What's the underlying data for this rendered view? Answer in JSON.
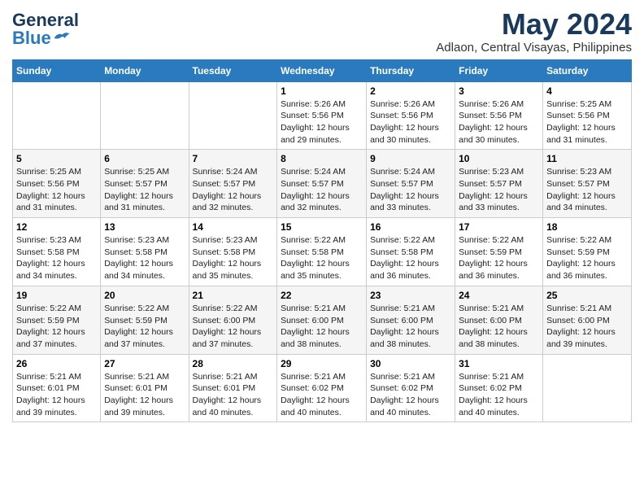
{
  "header": {
    "logo_general": "General",
    "logo_blue": "Blue",
    "month_title": "May 2024",
    "location": "Adlaon, Central Visayas, Philippines"
  },
  "days_of_week": [
    "Sunday",
    "Monday",
    "Tuesday",
    "Wednesday",
    "Thursday",
    "Friday",
    "Saturday"
  ],
  "weeks": [
    [
      {
        "day": "",
        "info": ""
      },
      {
        "day": "",
        "info": ""
      },
      {
        "day": "",
        "info": ""
      },
      {
        "day": "1",
        "info": "Sunrise: 5:26 AM\nSunset: 5:56 PM\nDaylight: 12 hours and 29 minutes."
      },
      {
        "day": "2",
        "info": "Sunrise: 5:26 AM\nSunset: 5:56 PM\nDaylight: 12 hours and 30 minutes."
      },
      {
        "day": "3",
        "info": "Sunrise: 5:26 AM\nSunset: 5:56 PM\nDaylight: 12 hours and 30 minutes."
      },
      {
        "day": "4",
        "info": "Sunrise: 5:25 AM\nSunset: 5:56 PM\nDaylight: 12 hours and 31 minutes."
      }
    ],
    [
      {
        "day": "5",
        "info": "Sunrise: 5:25 AM\nSunset: 5:56 PM\nDaylight: 12 hours and 31 minutes."
      },
      {
        "day": "6",
        "info": "Sunrise: 5:25 AM\nSunset: 5:57 PM\nDaylight: 12 hours and 31 minutes."
      },
      {
        "day": "7",
        "info": "Sunrise: 5:24 AM\nSunset: 5:57 PM\nDaylight: 12 hours and 32 minutes."
      },
      {
        "day": "8",
        "info": "Sunrise: 5:24 AM\nSunset: 5:57 PM\nDaylight: 12 hours and 32 minutes."
      },
      {
        "day": "9",
        "info": "Sunrise: 5:24 AM\nSunset: 5:57 PM\nDaylight: 12 hours and 33 minutes."
      },
      {
        "day": "10",
        "info": "Sunrise: 5:23 AM\nSunset: 5:57 PM\nDaylight: 12 hours and 33 minutes."
      },
      {
        "day": "11",
        "info": "Sunrise: 5:23 AM\nSunset: 5:57 PM\nDaylight: 12 hours and 34 minutes."
      }
    ],
    [
      {
        "day": "12",
        "info": "Sunrise: 5:23 AM\nSunset: 5:58 PM\nDaylight: 12 hours and 34 minutes."
      },
      {
        "day": "13",
        "info": "Sunrise: 5:23 AM\nSunset: 5:58 PM\nDaylight: 12 hours and 34 minutes."
      },
      {
        "day": "14",
        "info": "Sunrise: 5:23 AM\nSunset: 5:58 PM\nDaylight: 12 hours and 35 minutes."
      },
      {
        "day": "15",
        "info": "Sunrise: 5:22 AM\nSunset: 5:58 PM\nDaylight: 12 hours and 35 minutes."
      },
      {
        "day": "16",
        "info": "Sunrise: 5:22 AM\nSunset: 5:58 PM\nDaylight: 12 hours and 36 minutes."
      },
      {
        "day": "17",
        "info": "Sunrise: 5:22 AM\nSunset: 5:59 PM\nDaylight: 12 hours and 36 minutes."
      },
      {
        "day": "18",
        "info": "Sunrise: 5:22 AM\nSunset: 5:59 PM\nDaylight: 12 hours and 36 minutes."
      }
    ],
    [
      {
        "day": "19",
        "info": "Sunrise: 5:22 AM\nSunset: 5:59 PM\nDaylight: 12 hours and 37 minutes."
      },
      {
        "day": "20",
        "info": "Sunrise: 5:22 AM\nSunset: 5:59 PM\nDaylight: 12 hours and 37 minutes."
      },
      {
        "day": "21",
        "info": "Sunrise: 5:22 AM\nSunset: 6:00 PM\nDaylight: 12 hours and 37 minutes."
      },
      {
        "day": "22",
        "info": "Sunrise: 5:21 AM\nSunset: 6:00 PM\nDaylight: 12 hours and 38 minutes."
      },
      {
        "day": "23",
        "info": "Sunrise: 5:21 AM\nSunset: 6:00 PM\nDaylight: 12 hours and 38 minutes."
      },
      {
        "day": "24",
        "info": "Sunrise: 5:21 AM\nSunset: 6:00 PM\nDaylight: 12 hours and 38 minutes."
      },
      {
        "day": "25",
        "info": "Sunrise: 5:21 AM\nSunset: 6:00 PM\nDaylight: 12 hours and 39 minutes."
      }
    ],
    [
      {
        "day": "26",
        "info": "Sunrise: 5:21 AM\nSunset: 6:01 PM\nDaylight: 12 hours and 39 minutes."
      },
      {
        "day": "27",
        "info": "Sunrise: 5:21 AM\nSunset: 6:01 PM\nDaylight: 12 hours and 39 minutes."
      },
      {
        "day": "28",
        "info": "Sunrise: 5:21 AM\nSunset: 6:01 PM\nDaylight: 12 hours and 40 minutes."
      },
      {
        "day": "29",
        "info": "Sunrise: 5:21 AM\nSunset: 6:02 PM\nDaylight: 12 hours and 40 minutes."
      },
      {
        "day": "30",
        "info": "Sunrise: 5:21 AM\nSunset: 6:02 PM\nDaylight: 12 hours and 40 minutes."
      },
      {
        "day": "31",
        "info": "Sunrise: 5:21 AM\nSunset: 6:02 PM\nDaylight: 12 hours and 40 minutes."
      },
      {
        "day": "",
        "info": ""
      }
    ]
  ]
}
